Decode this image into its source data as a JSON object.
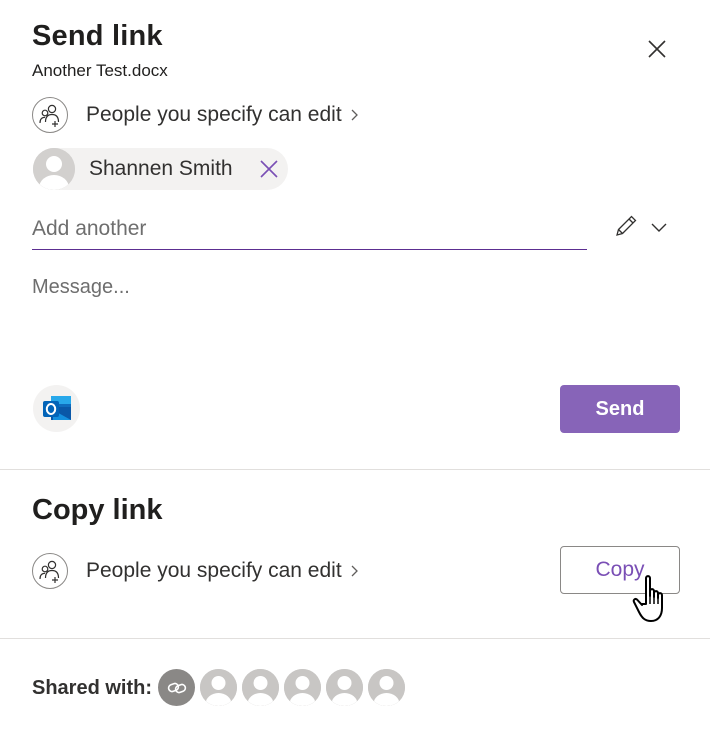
{
  "send_link": {
    "title": "Send link",
    "filename": "Another Test.docx",
    "permission_text": "People you specify can edit",
    "recipients": [
      {
        "name": "Shannen Smith"
      }
    ],
    "add_placeholder": "Add another",
    "message_placeholder": "Message...",
    "send_label": "Send"
  },
  "copy_link": {
    "title": "Copy link",
    "permission_text": "People you specify can edit",
    "copy_label": "Copy"
  },
  "shared_with": {
    "label": "Shared with:",
    "avatar_count": 5
  },
  "icons": {
    "close": "close-icon",
    "people": "people-add-icon",
    "chevron_right": "chevron-right-icon",
    "pencil": "pencil-icon",
    "chevron_down": "chevron-down-icon",
    "outlook": "outlook-icon",
    "link": "link-icon",
    "cursor": "hand-pointer-icon"
  },
  "colors": {
    "accent": "#8764b8",
    "copy_text": "#7a4fb5",
    "underline": "#5c2e91",
    "remove_x": "#7a4fb5"
  }
}
